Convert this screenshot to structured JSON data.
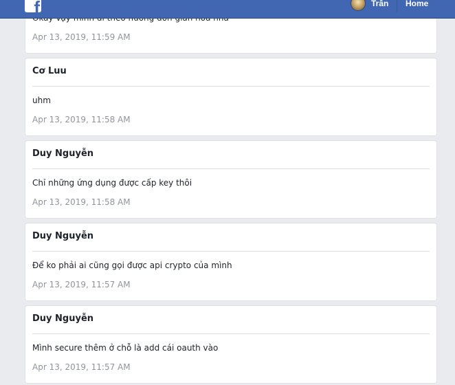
{
  "header": {
    "profile_name": "Trân",
    "home_label": "Home",
    "colors": {
      "bar": "#4267b2",
      "background": "#e9ebee"
    },
    "icons": {
      "logo": "facebook-logo-icon",
      "avatar": "avatar"
    }
  },
  "messages": [
    {
      "author": "",
      "text": "Okay vậy mình đi theo hướng đơn giản hoá nha",
      "time": "Apr 13, 2019, 11:59 AM"
    },
    {
      "author": "Cơ Luu",
      "text": "uhm",
      "time": "Apr 13, 2019, 11:58 AM"
    },
    {
      "author": "Duy Nguyễn",
      "text": "Chỉ những ứng dụng được cấp key thôi",
      "time": "Apr 13, 2019, 11:58 AM"
    },
    {
      "author": "Duy Nguyễn",
      "text": "Để ko phải ai cũng gọi được api crypto của mình",
      "time": "Apr 13, 2019, 11:57 AM"
    },
    {
      "author": "Duy Nguyễn",
      "text": "Mình secure thêm ở chỗ là add cái oauth vào",
      "time": "Apr 13, 2019, 11:57 AM"
    }
  ]
}
